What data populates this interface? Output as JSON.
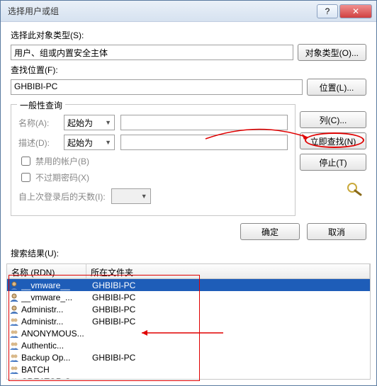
{
  "window": {
    "title": "选择用户或组"
  },
  "labels": {
    "object_type_label": "选择此对象类型(S):",
    "object_type_value": "用户、组或内置安全主体",
    "object_type_btn": "对象类型(O)...",
    "location_label": "查找位置(F):",
    "location_value": "GHBIBI-PC",
    "location_btn": "位置(L)...",
    "general_legend": "一般性查询",
    "name_label": "名称(A):",
    "desc_label": "描述(D):",
    "starts_with": "起始为",
    "cb_disabled": "禁用的帐户(B)",
    "cb_nonexpire": "不过期密码(X)",
    "days_label": "自上次登录后的天数(I):",
    "col_btn": "列(C)...",
    "find_now_btn": "立即查找(N)",
    "stop_btn": "停止(T)",
    "ok_btn": "确定",
    "cancel_btn": "取消",
    "results_label": "搜索结果(U):",
    "col_name": "名称 (RDN)",
    "col_loc": "所在文件夹"
  },
  "results": [
    {
      "icon": "user",
      "name": "__vmware__",
      "loc": "GHBIBI-PC",
      "selected": true
    },
    {
      "icon": "user",
      "name": "__vmware_...",
      "loc": "GHBIBI-PC"
    },
    {
      "icon": "user",
      "name": "Administr...",
      "loc": "GHBIBI-PC"
    },
    {
      "icon": "group",
      "name": "Administr...",
      "loc": "GHBIBI-PC"
    },
    {
      "icon": "group",
      "name": "ANONYMOUS...",
      "loc": ""
    },
    {
      "icon": "group",
      "name": "Authentic...",
      "loc": ""
    },
    {
      "icon": "group",
      "name": "Backup Op...",
      "loc": "GHBIBI-PC"
    },
    {
      "icon": "group",
      "name": "BATCH",
      "loc": ""
    },
    {
      "icon": "group",
      "name": "CREATOR G...",
      "loc": ""
    }
  ]
}
